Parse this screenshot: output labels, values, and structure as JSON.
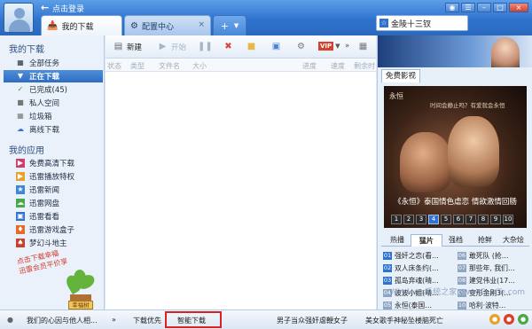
{
  "titlebar": {
    "login_text": "点击登录",
    "tabs": [
      {
        "label": "我的下载"
      },
      {
        "label": "配置中心"
      }
    ],
    "add_tab_label": "+",
    "search_box_text": "金陵十三钗"
  },
  "sidebar": {
    "my_downloads_title": "我的下载",
    "download_items": [
      {
        "label": "全部任务"
      },
      {
        "label": "正在下载"
      },
      {
        "label": "已完成(45)"
      },
      {
        "label": "私人空间"
      },
      {
        "label": "垃圾箱"
      },
      {
        "label": "离线下载"
      }
    ],
    "my_apps_title": "我的应用",
    "app_items": [
      {
        "label": "免费高清下载"
      },
      {
        "label": "迅雷播放特权"
      },
      {
        "label": "迅雷新闻"
      },
      {
        "label": "迅雷网盘"
      },
      {
        "label": "迅雷看看"
      },
      {
        "label": "迅雷游戏盒子"
      },
      {
        "label": "梦幻斗地主"
      }
    ],
    "promo_line1": "点击下载幸福",
    "promo_line2": "迅雷会员平价享",
    "promo_sign": "幸福树"
  },
  "toolbar": {
    "new_label": "新建",
    "start_label": "开始",
    "vip_label": "VIP"
  },
  "columns": [
    "状态",
    "类型",
    "文件名",
    "大小",
    "进度",
    "速度",
    "剩余时"
  ],
  "right_panel": {
    "tab_label": "免费影视",
    "poster_head": "永恒",
    "poster_sub": "时间会静止吗？有爱就会永恒",
    "poster_caption": "《永恒》泰国情色虐恋 情欲激情回肠",
    "pages": [
      "1",
      "2",
      "3",
      "4",
      "5",
      "6",
      "7",
      "8",
      "9",
      "10"
    ],
    "active_page": "4",
    "category_tabs": [
      "热播",
      "猛片",
      "强档",
      "抢鲜",
      "大杂烩"
    ],
    "active_category": "猛片",
    "movies_left": [
      {
        "n": "01",
        "title": "强奸之恋(看…"
      },
      {
        "n": "02",
        "title": "双人床条约(…"
      },
      {
        "n": "03",
        "title": "孤岛弃魂(晴…"
      },
      {
        "n": "04",
        "title": "波波小姐(晴…"
      },
      {
        "n": "05",
        "title": "永恒(泰国…"
      }
    ],
    "movies_right": [
      {
        "n": "06",
        "title": "敢死队 (抢…"
      },
      {
        "n": "07",
        "title": "那些年, 我们…"
      },
      {
        "n": "08",
        "title": "建党伟业(17…"
      },
      {
        "n": "09",
        "title": "变形金刚3(…"
      },
      {
        "n": "10",
        "title": "哈利·波特…"
      }
    ]
  },
  "statusbar": {
    "news_left": "我们的心因与他人相...",
    "more": "»",
    "priority": "下载优先",
    "smart": "智能下载",
    "news_mid": "男子当众强奸虐鞭女子",
    "news_right": "美女歌手神秘坠楼脑死亡"
  },
  "watermark": "Windows系统之家 www.DuoTe.com"
}
